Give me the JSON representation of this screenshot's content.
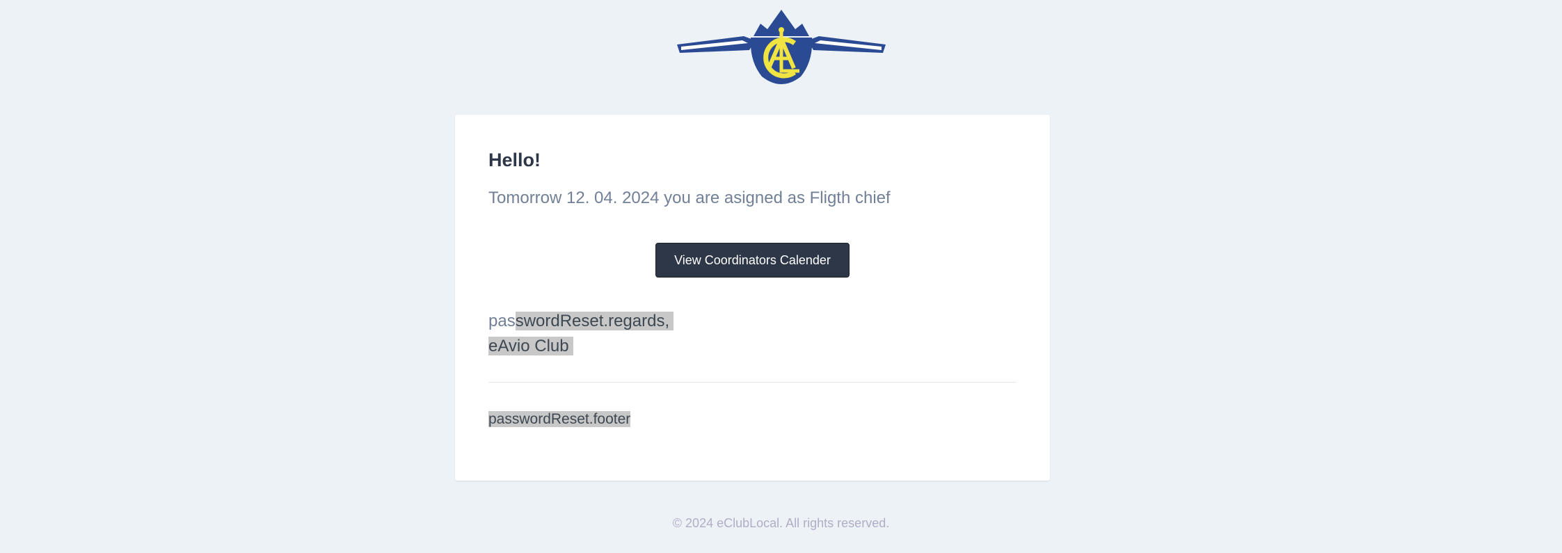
{
  "header": {
    "logo_icon": "eclub-winged-logo-icon",
    "logo_text": "AC"
  },
  "email": {
    "greeting": "Hello!",
    "intro": "Tomorrow 12. 04. 2024 you are asigned as Fligth chief",
    "action_label": "View Coordinators Calender",
    "regards_line1_plain": "pas",
    "regards_line1_highlight": "swordReset.regards,",
    "regards_line2": "eAvio Club",
    "footer_note": "passwordReset.footer"
  },
  "footer": {
    "copyright": "© 2024 eClubLocal. All rights reserved."
  },
  "colors": {
    "background": "#edf2f7",
    "card": "#ffffff",
    "button": "#2d3748",
    "logo_blue": "#2a4a94",
    "logo_yellow": "#f0e442"
  }
}
